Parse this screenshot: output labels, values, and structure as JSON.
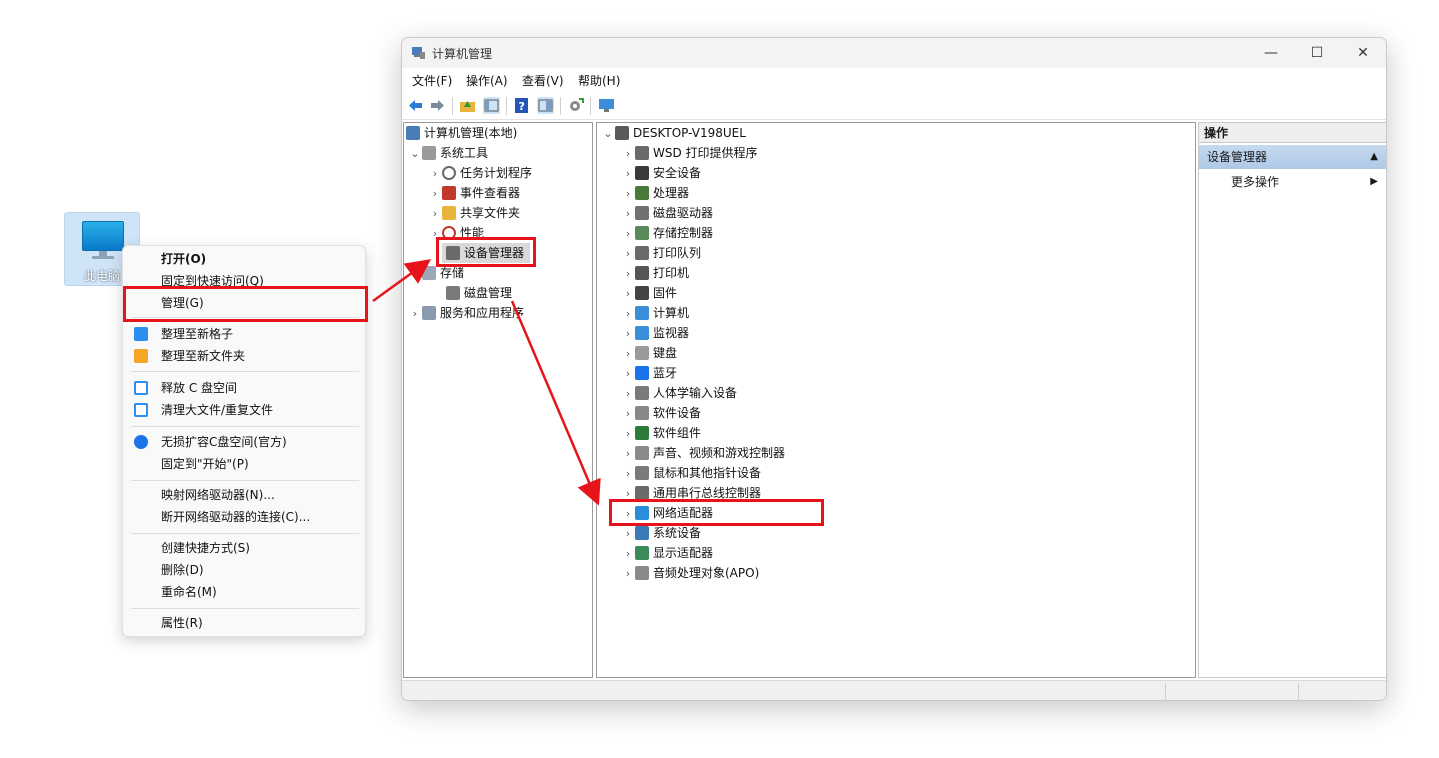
{
  "desktop": {
    "icon_label": "此电脑"
  },
  "context_menu": {
    "items": [
      {
        "label": "打开(O)",
        "bold": true
      },
      {
        "label": "固定到快速访问(Q)"
      },
      {
        "label": "管理(G)"
      },
      {
        "label": "整理至新格子",
        "icon_color": "#2b8ff0"
      },
      {
        "label": "整理至新文件夹",
        "icon_color": "#f5a623"
      },
      {
        "label": "释放 C 盘空间",
        "icon_color": "#2b8ff0"
      },
      {
        "label": "清理大文件/重复文件",
        "icon_color": "#2b8ff0"
      },
      {
        "label": "无损扩容C盘空间(官方)",
        "icon_color": "#1a73e8"
      },
      {
        "label": "固定到\"开始\"(P)"
      },
      {
        "label": "映射网络驱动器(N)..."
      },
      {
        "label": "断开网络驱动器的连接(C)..."
      },
      {
        "label": "创建快捷方式(S)"
      },
      {
        "label": "删除(D)"
      },
      {
        "label": "重命名(M)"
      },
      {
        "label": "属性(R)"
      }
    ]
  },
  "window": {
    "title": "计算机管理",
    "controls": {
      "minimize": "—",
      "maximize": "☐",
      "close": "✕"
    },
    "menu": [
      "文件(F)",
      "操作(A)",
      "查看(V)",
      "帮助(H)"
    ]
  },
  "left_tree": [
    {
      "label": "计算机管理(本地)",
      "chev": ""
    },
    {
      "label": "系统工具",
      "chev": "⌄"
    },
    {
      "label": "任务计划程序",
      "chev": "›"
    },
    {
      "label": "事件查看器",
      "chev": "›"
    },
    {
      "label": "共享文件夹",
      "chev": "›"
    },
    {
      "label": "性能",
      "chev": "›"
    },
    {
      "label": "设备管理器",
      "chev": ""
    },
    {
      "label": "存储",
      "chev": "⌄"
    },
    {
      "label": "磁盘管理",
      "chev": ""
    },
    {
      "label": "服务和应用程序",
      "chev": "›"
    }
  ],
  "device_tree": {
    "root": "DESKTOP-V198UEL",
    "items": [
      "WSD 打印提供程序",
      "安全设备",
      "处理器",
      "磁盘驱动器",
      "存储控制器",
      "打印队列",
      "打印机",
      "固件",
      "计算机",
      "监视器",
      "键盘",
      "蓝牙",
      "人体学输入设备",
      "软件设备",
      "软件组件",
      "声音、视频和游戏控制器",
      "鼠标和其他指针设备",
      "通用串行总线控制器",
      "网络适配器",
      "系统设备",
      "显示适配器",
      "音频处理对象(APO)"
    ]
  },
  "actions": {
    "header": "操作",
    "section": "设备管理器",
    "more": "更多操作"
  },
  "colors": {
    "highlight": "#e8141b",
    "actions_band": "#b9d0ea"
  }
}
